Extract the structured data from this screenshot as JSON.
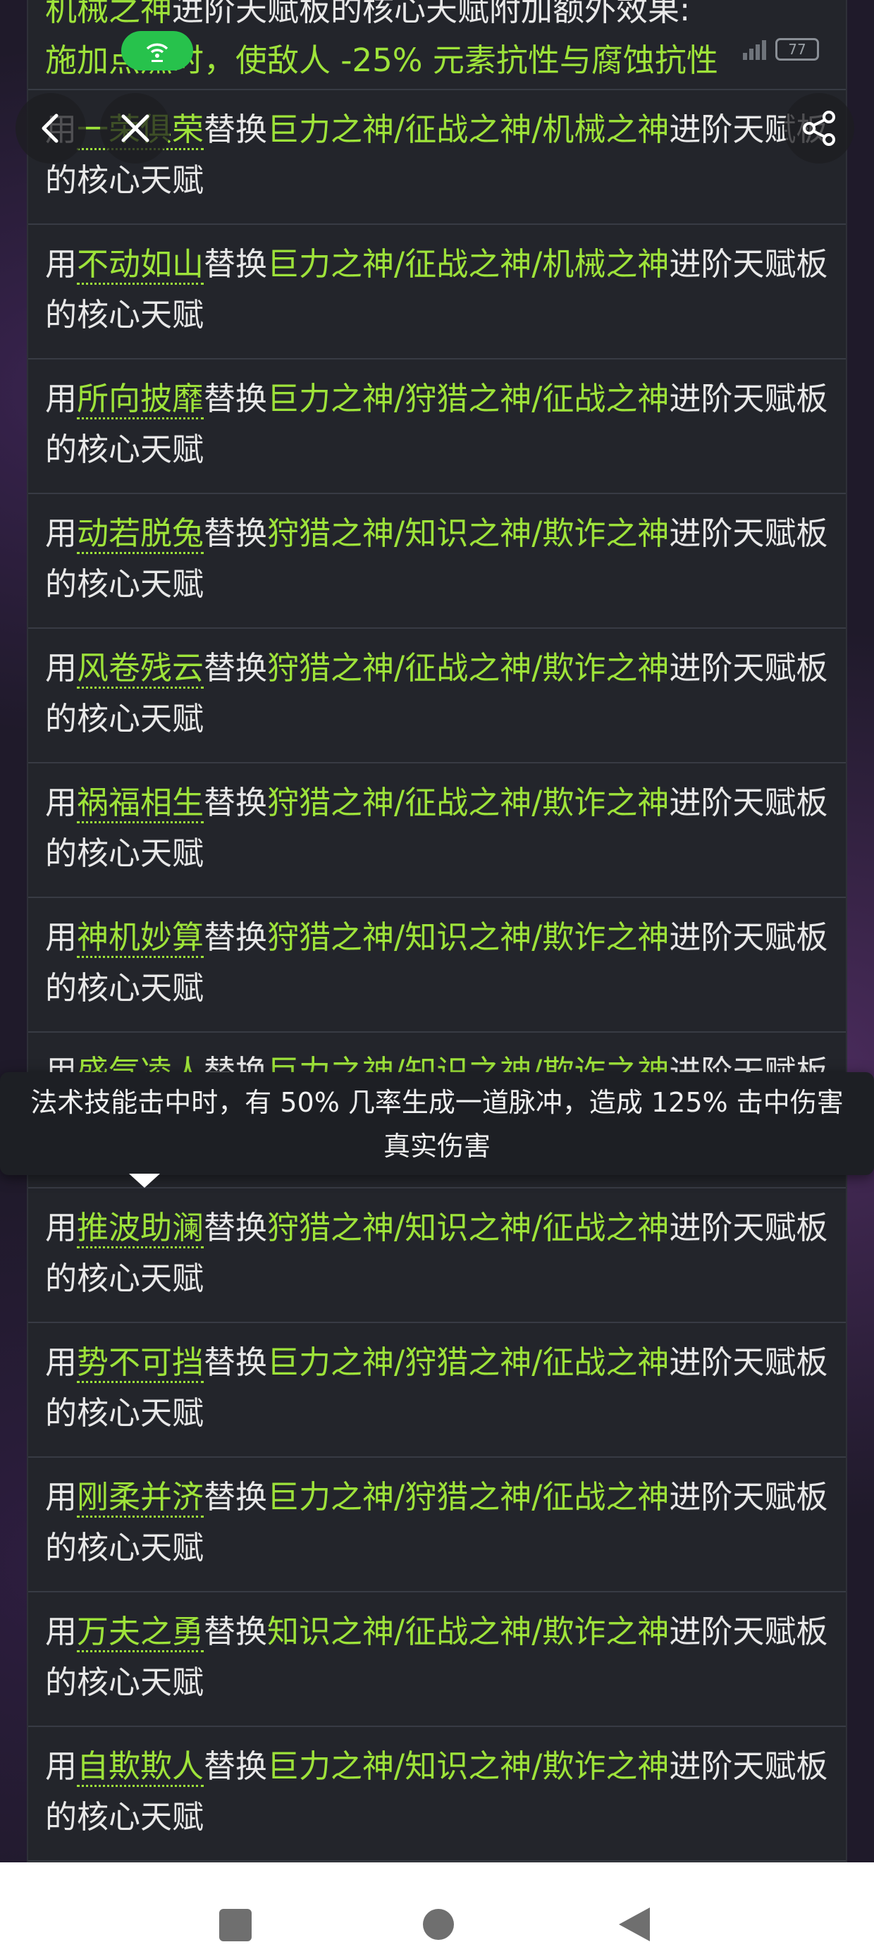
{
  "top_fragment": {
    "line1_green": "机械之神",
    "line1_rest": "进阶天赋板的核心天赋附加额外效果:",
    "line2": "施加点燃时，使敌人 -25% 元素抗性与腐蚀抗性"
  },
  "status_bar": {
    "battery": "77"
  },
  "rows": [
    {
      "prefix": "用",
      "talent": "一荣俱荣",
      "mid": "替换",
      "gods": "巨力之神/征战之神/机械之神",
      "suffix": "进阶天赋板的核心天赋"
    },
    {
      "prefix": "用",
      "talent": "不动如山",
      "mid": "替换",
      "gods": "巨力之神/征战之神/机械之神",
      "suffix": "进阶天赋板的核心天赋"
    },
    {
      "prefix": "用",
      "talent": "所向披靡",
      "mid": "替换",
      "gods": "巨力之神/狩猎之神/征战之神",
      "suffix": "进阶天赋板的核心天赋"
    },
    {
      "prefix": "用",
      "talent": "动若脱兔",
      "mid": "替换",
      "gods": "狩猎之神/知识之神/欺诈之神",
      "suffix": "进阶天赋板的核心天赋"
    },
    {
      "prefix": "用",
      "talent": "风卷残云",
      "mid": "替换",
      "gods": "狩猎之神/征战之神/欺诈之神",
      "suffix": "进阶天赋板的核心天赋"
    },
    {
      "prefix": "用",
      "talent": "祸福相生",
      "mid": "替换",
      "gods": "狩猎之神/征战之神/欺诈之神",
      "suffix": "进阶天赋板的核心天赋"
    },
    {
      "prefix": "用",
      "talent": "神机妙算",
      "mid": "替换",
      "gods": "狩猎之神/知识之神/欺诈之神",
      "suffix": "进阶天赋板的核心天赋"
    },
    {
      "prefix": "用",
      "talent": "盛气凌人",
      "mid": "替换",
      "gods": "巨力之神/知识之神/欺诈之神",
      "suffix": "进阶天赋板的核心天赋"
    },
    {
      "prefix": "用",
      "talent": "推波助澜",
      "mid": "替换",
      "gods": "狩猎之神/知识之神/征战之神",
      "suffix": "进阶天赋板的核心天赋"
    },
    {
      "prefix": "用",
      "talent": "势不可挡",
      "mid": "替换",
      "gods": "巨力之神/狩猎之神/征战之神",
      "suffix": "进阶天赋板的核心天赋"
    },
    {
      "prefix": "用",
      "talent": "刚柔并济",
      "mid": "替换",
      "gods": "巨力之神/狩猎之神/征战之神",
      "suffix": "进阶天赋板的核心天赋"
    },
    {
      "prefix": "用",
      "talent": "万夫之勇",
      "mid": "替换",
      "gods": "知识之神/征战之神/欺诈之神",
      "suffix": "进阶天赋板的核心天赋"
    },
    {
      "prefix": "用",
      "talent": "自欺欺人",
      "mid": "替换",
      "gods": "巨力之神/知识之神/欺诈之神",
      "suffix": "进阶天赋板的核心天赋"
    }
  ],
  "tooltip": {
    "line1": "法术技能击中时，有 50% 几率生成一道脉冲，造成 125% 击中伤害",
    "line2": "真实伤害"
  }
}
